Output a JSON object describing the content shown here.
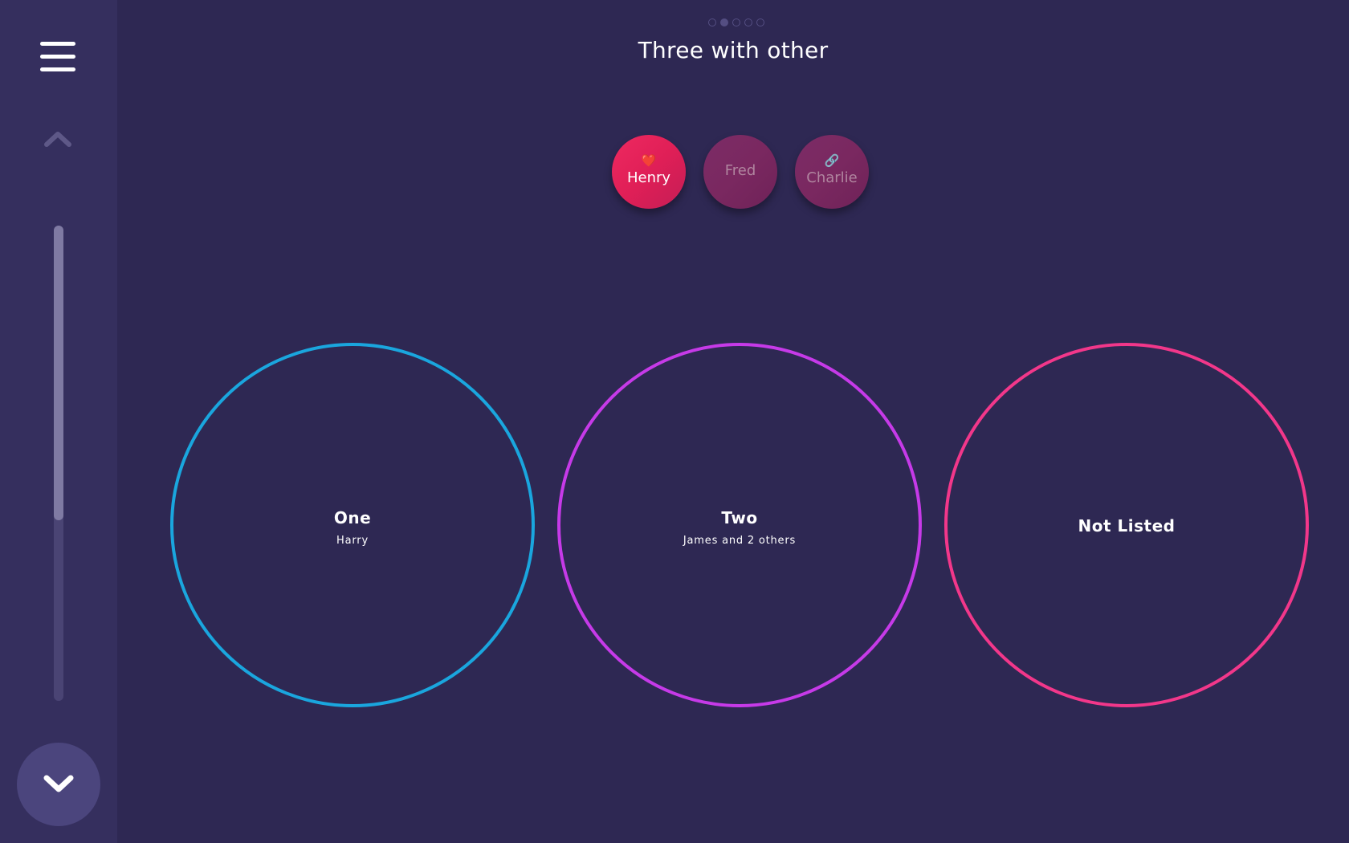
{
  "page": {
    "title": "Three with other",
    "pager": {
      "total": 5,
      "current": 2
    }
  },
  "sidebar": {
    "menu_icon": "hamburger-menu-icon",
    "up_icon": "chevron-up-icon",
    "down_icon": "chevron-down-icon",
    "scroll_position": 0.62
  },
  "chips": [
    {
      "label": "Henry",
      "icon": "heart-icon",
      "glyph": "❤️",
      "selected": true
    },
    {
      "label": "Fred",
      "icon": "",
      "glyph": "",
      "selected": false
    },
    {
      "label": "Charlie",
      "icon": "link-icon",
      "glyph": "🔗",
      "selected": false
    }
  ],
  "options": [
    {
      "title": "One",
      "subtitle": "Harry",
      "color": "#1aa6de"
    },
    {
      "title": "Two",
      "subtitle": "James and 2 others",
      "color": "#c63ae8"
    },
    {
      "title": "Not Listed",
      "subtitle": "",
      "color": "#f2378a"
    }
  ],
  "colors": {
    "background": "#2e2853",
    "sidebar": "#352f5e",
    "chip_selected": "#e8245d",
    "chip_unselected": "#7a2860"
  }
}
